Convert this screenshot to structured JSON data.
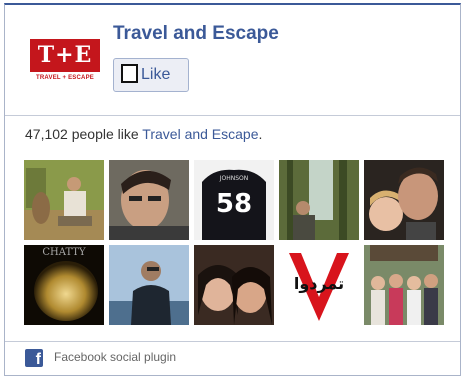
{
  "page": {
    "name": "Travel and Escape",
    "logo_text": "T+E",
    "logo_tagline": "TRAVEL + ESCAPE"
  },
  "like_button": {
    "label": "Like"
  },
  "likes": {
    "count_text": "47,102 people like ",
    "page_link": "Travel and Escape",
    "period": "."
  },
  "jersey_number": "58",
  "jersey_name": "JOHNSON",
  "chatty_text": "CHATTY",
  "arabic_text": "تمردوا",
  "footer": {
    "text": "Facebook social plugin",
    "icon": "facebook-icon"
  },
  "colors": {
    "brand": "#3b5998",
    "logo_red": "#c4161c"
  }
}
